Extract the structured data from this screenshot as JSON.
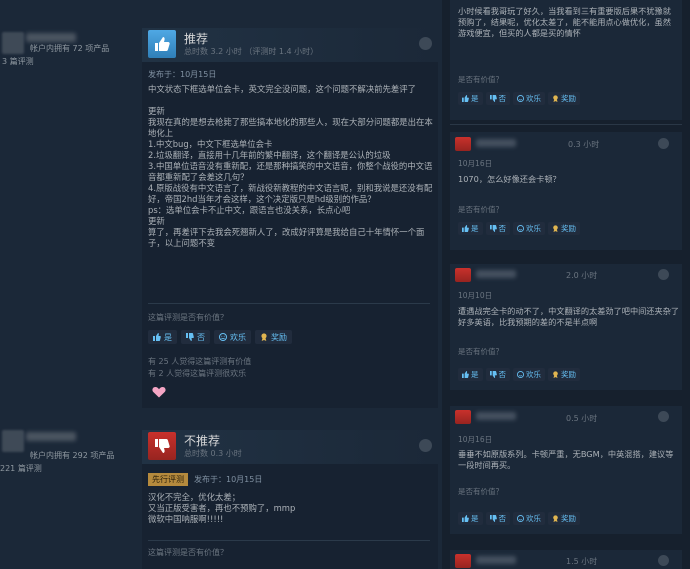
{
  "reviews": [
    {
      "owned": "帐户内拥有 72 项产品",
      "review_count": "3 篇评测",
      "verdict": "推荐",
      "hours": "总时数 3.2 小时 （评测时 1.4 小时）",
      "posted": "发布于：10月15日",
      "early_access_tag": "",
      "body": "中文状态下框选单位会卡，英文完全没问题，这个问题不解决前先差评了\n\n更新\n我现在真的是想去枪毙了那些搞本地化的那些人，现在大部分问题都是出在本地化上\n1.中文bug，中文下框选单位会卡\n2.垃圾翻译，直接用十几年前的繁中翻译，这个翻译是公认的垃圾\n3.中国单位语音没有重新配，还是那种搞笑的中文语音，你整个战役的中文语音都重新配了会差这几句？\n4.原版战役有中文语言了，新战役新教程的中文语言呢，别和我说是还没有配好，帝国2hd当年才会这样，这个决定版只是hd级别的作品？\nps：选单位会卡不止中文，跟语言也没关系，长点心吧\n更新\n算了，再差评下去我会死翘新人了，改成好评算是我给自己十年情怀一个面子，以上问题不变",
      "helpful_q": "这篇评测是否有价值？",
      "vote_yes": "是",
      "vote_no": "否",
      "vote_funny": "欢乐",
      "vote_award": "奖励",
      "helpful_count": "有 25 人觉得这篇评测有价值",
      "funny_count": "有 2 人觉得这篇评测很欢乐"
    },
    {
      "owned": "帐户内拥有 292 项产品",
      "review_count": "221 篇评测",
      "verdict": "不推荐",
      "hours": "总时数 0.3 小时",
      "posted": "发布于：10月15日",
      "early_access_tag": "先行评测",
      "body": "汉化不完全，优化太差；\n又当正版受害者，再也不预购了，mmp\n微软中国呐服啊!!!!!",
      "helpful_q": "这篇评测是否有价值？"
    }
  ],
  "side_comments": [
    {
      "text": "小时候看我哥玩了好久，当我看到三有重要版后果不犹豫就预购了，结果呢，优化太差了，能不能用点心做优化，虽然游戏便宜，但买的人都是买的情怀",
      "question": "是否有价值？",
      "yes": "是",
      "no": "否",
      "funny": "欢乐",
      "award": "奖励"
    },
    {
      "hours": "0.3 小时",
      "date": "10月16日",
      "text": "1070，怎么好像还会卡顿？",
      "question": "是否有价值？",
      "yes": "是",
      "no": "否",
      "funny": "欢乐",
      "award": "奖励"
    },
    {
      "hours": "2.0 小时",
      "date": "10月10日",
      "text": "遭遇战完全卡的动不了，中文翻译的太差劲了吧中间还夹杂了好多英语，比我预期的差的不是半点啊",
      "question": "是否有价值？",
      "yes": "是",
      "no": "否",
      "funny": "欢乐",
      "award": "奖励"
    },
    {
      "hours": "0.5 小时",
      "date": "10月16日",
      "text": "垂垂不如原版系列。卡顿严重，无BGM，中英混搭，建议等一段时间再买。",
      "question": "是否有价值？",
      "yes": "是",
      "no": "否",
      "funny": "欢乐",
      "award": "奖励"
    },
    {
      "hours": "1.5 小时"
    }
  ],
  "colors": {
    "accent": "#66c0f4",
    "recommend": "#3d8fd1",
    "not_recommend": "#b8302b",
    "bg": "#1b2838"
  },
  "icons": [
    "thumbs-up-icon",
    "thumbs-down-icon",
    "smiley-icon",
    "award-icon",
    "steam-logo-icon",
    "heart-icon"
  ]
}
